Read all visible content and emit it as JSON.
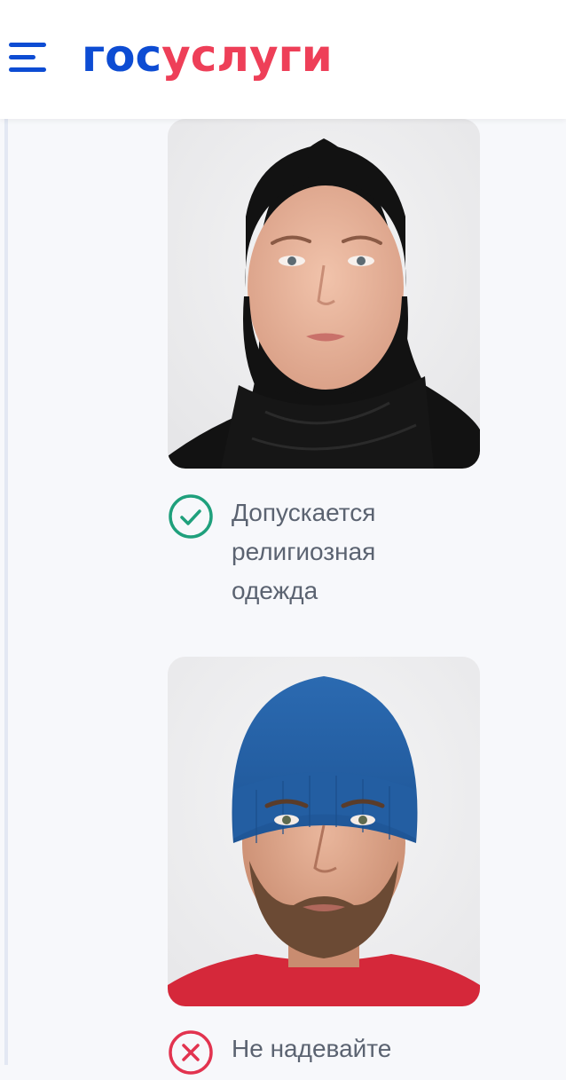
{
  "header": {
    "logo_part1": "гос",
    "logo_part2": "услуги",
    "menu_icon": "hamburger-menu-icon"
  },
  "examples": [
    {
      "image": "photo-woman-headscarf",
      "status": "allowed",
      "status_icon": "check-circle-icon",
      "text": "Допускается религиозная одежда"
    },
    {
      "image": "photo-man-beanie",
      "status": "not-allowed",
      "status_icon": "cross-circle-icon",
      "text": "Не надевайте"
    }
  ],
  "colors": {
    "brand_blue": "#0d4cd3",
    "brand_red": "#ee3f58",
    "allowed_green": "#1fa07c",
    "forbidden_red": "#e2334f",
    "text_gray": "#5b6371"
  }
}
